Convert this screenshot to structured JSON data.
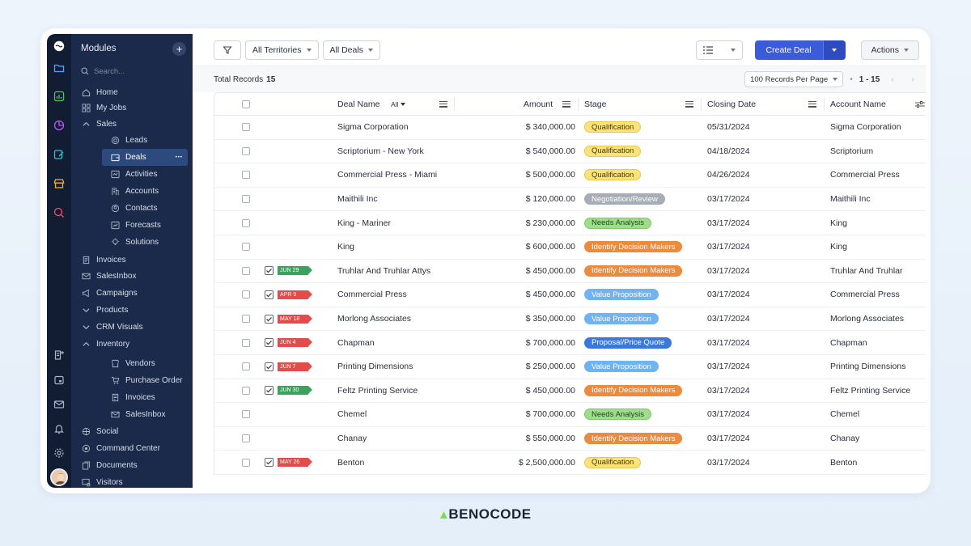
{
  "sidebar": {
    "title": "Modules",
    "search_placeholder": "Search...",
    "items": [
      {
        "label": "Home",
        "icon": "home-icon",
        "level": 0
      },
      {
        "label": "My Jobs",
        "icon": "grid-icon",
        "level": 0
      },
      {
        "label": "Sales",
        "icon": "chevron-up-icon",
        "level": 0
      },
      {
        "label": "Leads",
        "icon": "target-icon",
        "level": 1
      },
      {
        "label": "Deals",
        "icon": "wallet-icon",
        "level": 1,
        "active": true
      },
      {
        "label": "Activities",
        "icon": "activity-icon",
        "level": 1
      },
      {
        "label": "Accounts",
        "icon": "building-icon",
        "level": 1
      },
      {
        "label": "Contacts",
        "icon": "contact-icon",
        "level": 1
      },
      {
        "label": "Forecasts",
        "icon": "forecast-icon",
        "level": 1
      },
      {
        "label": "Solutions",
        "icon": "bulb-icon",
        "level": 1
      },
      {
        "label": "Invoices",
        "icon": "invoice-icon",
        "level": 0
      },
      {
        "label": "SalesInbox",
        "icon": "mail-icon",
        "level": 0
      },
      {
        "label": "Campaigns",
        "icon": "megaphone-icon",
        "level": 0
      },
      {
        "label": "Products",
        "icon": "chevron-down-icon",
        "level": 0
      },
      {
        "label": "CRM Visuals",
        "icon": "chevron-down-icon",
        "level": 0
      },
      {
        "label": "Inventory",
        "icon": "chevron-up-icon",
        "level": 0
      },
      {
        "label": "Vendors",
        "icon": "store-icon",
        "level": 1
      },
      {
        "label": "Purchase Order",
        "icon": "cart-icon",
        "level": 1
      },
      {
        "label": "Invoices",
        "icon": "invoice-icon",
        "level": 1
      },
      {
        "label": "SalesInbox",
        "icon": "mail-icon",
        "level": 1
      },
      {
        "label": "Social",
        "icon": "social-icon",
        "level": 0
      },
      {
        "label": "Command Center",
        "icon": "command-icon",
        "level": 0
      },
      {
        "label": "Documents",
        "icon": "documents-icon",
        "level": 0
      },
      {
        "label": "Visitors",
        "icon": "visitors-icon",
        "level": 0
      }
    ]
  },
  "toolbar": {
    "territory_label": "All Territories",
    "deals_label": "All Deals",
    "create_label": "Create Deal",
    "actions_label": "Actions"
  },
  "subbar": {
    "total_label": "Total Records",
    "total_count": "15",
    "per_page": "100 Records Per Page",
    "range": "1 - 15"
  },
  "table": {
    "headers": {
      "deal_name": "Deal Name",
      "deal_filter": "All",
      "amount": "Amount",
      "stage": "Stage",
      "closing_date": "Closing Date",
      "account_name": "Account Name"
    },
    "rows": [
      {
        "tag": "",
        "deal": "Sigma Corporation",
        "amount": "$ 340,000.00",
        "stage": "Qualification",
        "date": "05/31/2024",
        "account": "Sigma Corporation"
      },
      {
        "tag": "",
        "deal": "Scriptorium - New York",
        "amount": "$ 540,000.00",
        "stage": "Qualification",
        "date": "04/18/2024",
        "account": "Scriptorium"
      },
      {
        "tag": "",
        "deal": "Commercial Press - Miami",
        "amount": "$ 500,000.00",
        "stage": "Qualification",
        "date": "04/26/2024",
        "account": "Commercial Press"
      },
      {
        "tag": "",
        "deal": "Maithili Inc",
        "amount": "$ 120,000.00",
        "stage": "Negotiation/Review",
        "date": "03/17/2024",
        "account": "Maithili Inc"
      },
      {
        "tag": "",
        "deal": "King - Mariner",
        "amount": "$ 230,000.00",
        "stage": "Needs Analysis",
        "date": "03/17/2024",
        "account": "King"
      },
      {
        "tag": "",
        "deal": "King",
        "amount": "$ 600,000.00",
        "stage": "Identify Decision Makers",
        "date": "03/17/2024",
        "account": "King"
      },
      {
        "tag": "JUN 29",
        "tag_color": "green",
        "deal": "Truhlar And Truhlar Attys",
        "amount": "$ 450,000.00",
        "stage": "Identify Decision Makers",
        "date": "03/17/2024",
        "account": "Truhlar And Truhlar"
      },
      {
        "tag": "APR 9",
        "tag_color": "red",
        "deal": "Commercial Press",
        "amount": "$ 450,000.00",
        "stage": "Value Proposition",
        "date": "03/17/2024",
        "account": "Commercial Press"
      },
      {
        "tag": "MAY 18",
        "tag_color": "red",
        "deal": "Morlong Associates",
        "amount": "$ 350,000.00",
        "stage": "Value Proposition",
        "date": "03/17/2024",
        "account": "Morlong Associates"
      },
      {
        "tag": "JUN 4",
        "tag_color": "red",
        "deal": "Chapman",
        "amount": "$ 700,000.00",
        "stage": "Proposal/Price Quote",
        "date": "03/17/2024",
        "account": "Chapman"
      },
      {
        "tag": "JUN 7",
        "tag_color": "red",
        "deal": "Printing Dimensions",
        "amount": "$ 250,000.00",
        "stage": "Value Proposition",
        "date": "03/17/2024",
        "account": "Printing Dimensions"
      },
      {
        "tag": "JUN 30",
        "tag_color": "green",
        "deal": "Feltz Printing Service",
        "amount": "$ 450,000.00",
        "stage": "Identify Decision Makers",
        "date": "03/17/2024",
        "account": "Feltz Printing Service"
      },
      {
        "tag": "",
        "deal": "Chemel",
        "amount": "$ 700,000.00",
        "stage": "Needs Analysis",
        "date": "03/17/2024",
        "account": "Chemel"
      },
      {
        "tag": "",
        "deal": "Chanay",
        "amount": "$ 550,000.00",
        "stage": "Identify Decision Makers",
        "date": "03/17/2024",
        "account": "Chanay"
      },
      {
        "tag": "MAY 26",
        "tag_color": "red",
        "deal": "Benton",
        "amount": "$ 2,500,000.00",
        "stage": "Qualification",
        "date": "03/17/2024",
        "account": "Benton"
      }
    ]
  },
  "stage_colors": {
    "Qualification": {
      "bg": "#fbe27a",
      "fg": "#4a3b00",
      "border": "#e7c94a"
    },
    "Negotiation/Review": {
      "bg": "#a7acb6",
      "fg": "#ffffff",
      "border": "#a7acb6"
    },
    "Needs Analysis": {
      "bg": "#9fdc8b",
      "fg": "#1f4a14",
      "border": "#7fc96a"
    },
    "Identify Decision Makers": {
      "bg": "#ec8a3e",
      "fg": "#ffffff",
      "border": "#ec8a3e"
    },
    "Value Proposition": {
      "bg": "#6fb3f2",
      "fg": "#ffffff",
      "border": "#6fb3f2"
    },
    "Proposal/Price Quote": {
      "bg": "#3a78e0",
      "fg": "#ffffff",
      "border": "#3a78e0"
    }
  },
  "tag_colors": {
    "green": "#3aa35b",
    "red": "#e24c4b"
  },
  "brand": {
    "name": "BENOCODE",
    "accent": "#7ed957"
  }
}
